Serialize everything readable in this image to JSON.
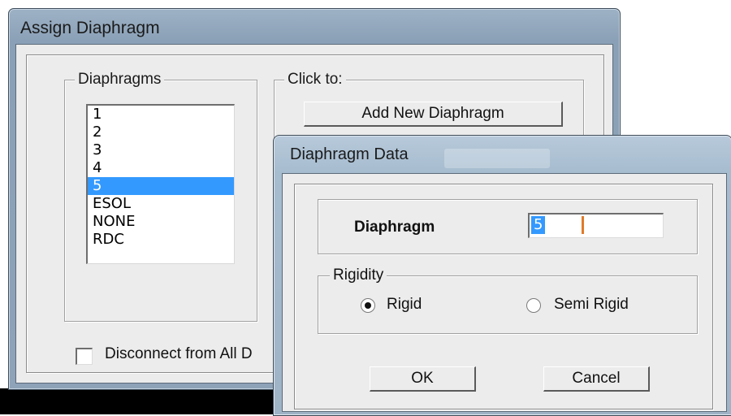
{
  "assign_window": {
    "title": "Assign Diaphragm",
    "diaphragms_group": {
      "legend": "Diaphragms",
      "items": [
        "1",
        "2",
        "3",
        "4",
        "5",
        "ESOL",
        "NONE",
        "RDC"
      ],
      "selected": "5"
    },
    "click_to_group": {
      "legend": "Click to:",
      "add_button": "Add New Diaphragm"
    },
    "disconnect_checkbox": {
      "label": "Disconnect from All D",
      "checked": false
    }
  },
  "data_window": {
    "title": "Diaphragm Data",
    "diaphragm_label": "Diaphragm",
    "diaphragm_value": "5",
    "rigidity": {
      "legend": "Rigidity",
      "options": [
        "Rigid",
        "Semi Rigid"
      ],
      "selected": "Rigid"
    },
    "ok_button": "OK",
    "cancel_button": "Cancel"
  },
  "colors": {
    "selection": "#3399ff",
    "dialog_face": "#ececec",
    "titlebar": "#9eb2c6"
  }
}
